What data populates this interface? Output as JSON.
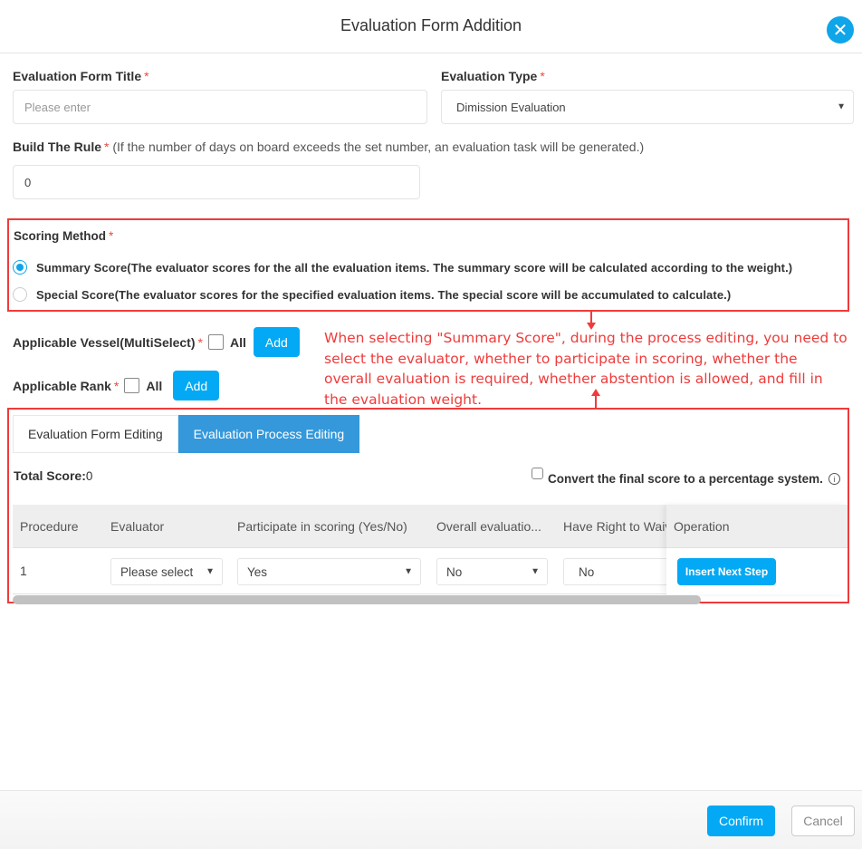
{
  "header": {
    "title": "Evaluation Form Addition",
    "close_icon": "close-icon"
  },
  "form": {
    "title_field": {
      "label": "Evaluation Form Title",
      "required_mark": "*",
      "placeholder": "Please enter",
      "value": ""
    },
    "type_field": {
      "label": "Evaluation Type",
      "required_mark": "*",
      "selected": "Dimission Evaluation"
    },
    "rule_field": {
      "label": "Build The Rule",
      "required_mark": "*",
      "hint": "(If the number of days on board exceeds the set number, an evaluation task will be generated.)",
      "value": "0"
    },
    "scoring_method": {
      "label": "Scoring Method",
      "required_mark": "*",
      "options": [
        {
          "label": "Summary Score(The evaluator scores for the all the evaluation items. The summary score will be calculated according to the weight.)",
          "checked": true
        },
        {
          "label": "Special Score(The evaluator scores for the specified evaluation items. The special score will be accumulated to calculate.)",
          "checked": false
        }
      ]
    },
    "vessel": {
      "label": "Applicable Vessel(MultiSelect)",
      "required_mark": "*",
      "all_label": "All",
      "all_checked": false,
      "add_label": "Add"
    },
    "rank": {
      "label": "Applicable Rank",
      "required_mark": "*",
      "all_label": "All",
      "all_checked": false,
      "add_label": "Add"
    }
  },
  "annotation": {
    "text": "When selecting \"Summary Score\", during the process editing, you need to select the evaluator, whether to participate in scoring, whether the overall evaluation is required, whether abstention is allowed, and fill in the evaluation weight.",
    "color": "#ef3b3b"
  },
  "tabs": [
    {
      "label": "Evaluation Form Editing",
      "active": false
    },
    {
      "label": "Evaluation Process Editing",
      "active": true
    }
  ],
  "process": {
    "total_score_label": "Total Score:",
    "total_score_value": "0",
    "convert_label": "Convert the final score to a percentage system.",
    "convert_checked": false,
    "info_icon": "info-icon",
    "columns": [
      "Procedure",
      "Evaluator",
      "Participate in scoring (Yes/No)",
      "Overall evaluatio...",
      "Have Right to Waive",
      "Operation"
    ],
    "rows": [
      {
        "procedure": "1",
        "evaluator": "Please select",
        "participate": "Yes",
        "overall": "No",
        "waive": "No",
        "operation": "Insert Next Step"
      }
    ]
  },
  "footer": {
    "confirm_label": "Confirm",
    "cancel_label": "Cancel"
  },
  "colors": {
    "accent": "#03a9f4",
    "tab_active": "#3498db",
    "required": "#e74c3c",
    "highlight_box": "#ef3b3b"
  }
}
